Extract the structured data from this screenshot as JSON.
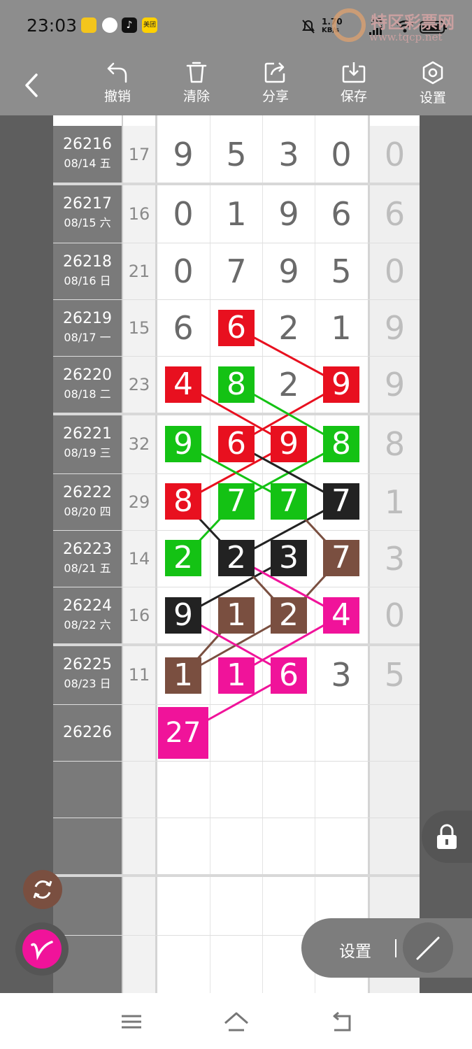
{
  "status_bar": {
    "time": "23:03",
    "net_speed_top": "1.70",
    "net_speed_unit": "KB/s",
    "signal_label": "5G",
    "app_icon_label": "美团"
  },
  "watermark": {
    "title": "特区彩票网",
    "url": "www.tqcp.net"
  },
  "toolbar": {
    "undo_label": "撤销",
    "clear_label": "清除",
    "share_label": "分享",
    "save_label": "保存",
    "settings_label": "设置"
  },
  "rows": [
    {
      "issue": "26216",
      "date": "08/14 五",
      "sum": "17",
      "digits": [
        "9",
        "5",
        "3",
        "0"
      ],
      "last": "0"
    },
    {
      "issue": "26217",
      "date": "08/15 六",
      "sum": "16",
      "digits": [
        "0",
        "1",
        "9",
        "6"
      ],
      "last": "6"
    },
    {
      "issue": "26218",
      "date": "08/16 日",
      "sum": "21",
      "digits": [
        "0",
        "7",
        "9",
        "5"
      ],
      "last": "0"
    },
    {
      "issue": "26219",
      "date": "08/17 一",
      "sum": "15",
      "digits": [
        "6",
        "6",
        "2",
        "1"
      ],
      "last": "9"
    },
    {
      "issue": "26220",
      "date": "08/18 二",
      "sum": "23",
      "digits": [
        "4",
        "8",
        "2",
        "9"
      ],
      "last": "9"
    },
    {
      "issue": "26221",
      "date": "08/19 三",
      "sum": "32",
      "digits": [
        "9",
        "6",
        "9",
        "8"
      ],
      "last": "8"
    },
    {
      "issue": "26222",
      "date": "08/20 四",
      "sum": "29",
      "digits": [
        "8",
        "7",
        "7",
        "7"
      ],
      "last": "1"
    },
    {
      "issue": "26223",
      "date": "08/21 五",
      "sum": "14",
      "digits": [
        "2",
        "2",
        "3",
        "7"
      ],
      "last": "3"
    },
    {
      "issue": "26224",
      "date": "08/22 六",
      "sum": "16",
      "digits": [
        "9",
        "1",
        "2",
        "4"
      ],
      "last": "0"
    },
    {
      "issue": "26225",
      "date": "08/23 日",
      "sum": "11",
      "digits": [
        "1",
        "1",
        "6",
        "3"
      ],
      "last": "5"
    },
    {
      "issue": "26226",
      "date": "",
      "sum": "",
      "digits": [
        "27",
        "",
        "",
        ""
      ],
      "last": ""
    }
  ],
  "colors": {
    "red": "#e8101f",
    "green": "#14c214",
    "black": "#222222",
    "brown": "#7a4f40",
    "pink": "#f0139a"
  },
  "floating": {
    "settings_label": "设置",
    "lock_icon": "lock-icon",
    "sync_icon": "sync-icon",
    "pen_icon": "pen-icon"
  }
}
